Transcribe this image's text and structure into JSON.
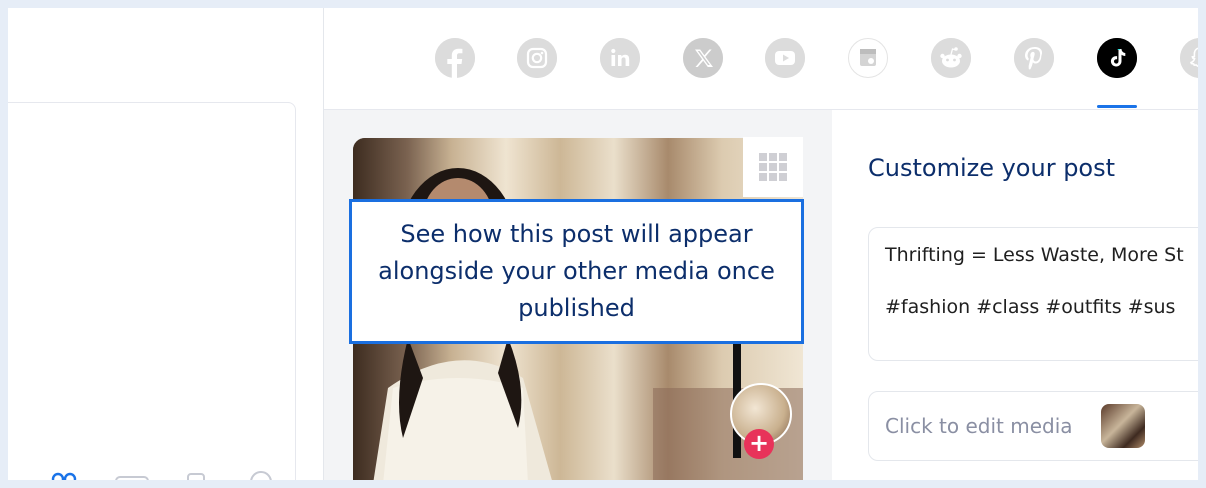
{
  "networks": [
    {
      "name": "facebook-icon",
      "color": "#dcdcdc"
    },
    {
      "name": "instagram-icon",
      "color": "#dcdcdc"
    },
    {
      "name": "linkedin-icon",
      "color": "#dcdcdc"
    },
    {
      "name": "x-icon",
      "color": "#cccccc"
    },
    {
      "name": "youtube-icon",
      "color": "#dcdcdc"
    },
    {
      "name": "google-business-icon",
      "color": "#dcdcdc"
    },
    {
      "name": "reddit-icon",
      "color": "#dcdcdc"
    },
    {
      "name": "pinterest-icon",
      "color": "#dcdcdc"
    },
    {
      "name": "tiktok-icon",
      "color": "#000000",
      "selected": true
    },
    {
      "name": "snapchat-icon",
      "color": "#dcdcdc"
    }
  ],
  "tooltip": {
    "text": "See how this post will appear alongside your other media once published"
  },
  "settings": {
    "title": "Customize your post",
    "caption_line1": "Thrifting = Less Waste, More St",
    "caption_line2": "#fashion #class #outfits #sus",
    "media_label": "Click to edit media"
  },
  "colors": {
    "accent": "#1a73e8",
    "title": "#0c2e6b",
    "add_badge": "#e8335a"
  }
}
